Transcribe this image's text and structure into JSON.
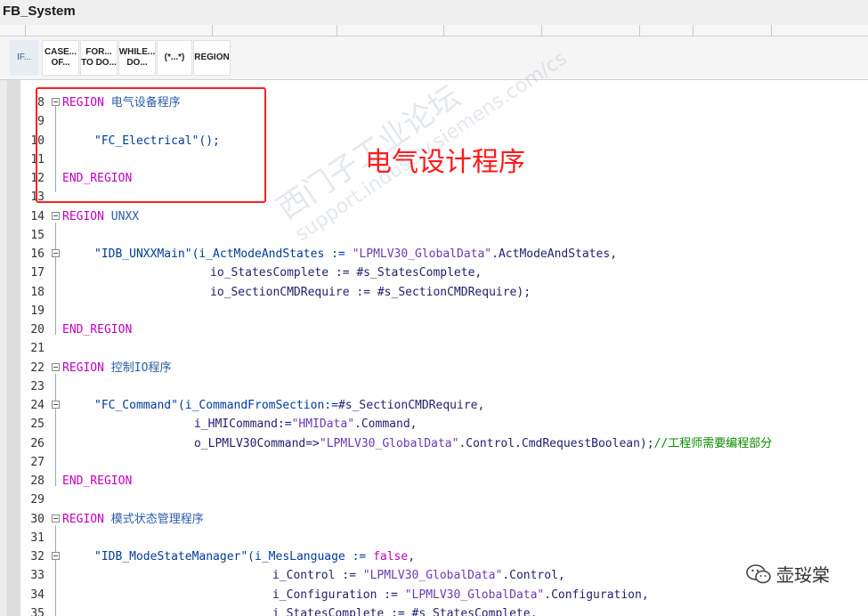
{
  "window": {
    "title": "FB_System"
  },
  "toolbar": {
    "buttons": [
      {
        "name": "if-button",
        "line1": "IF...",
        "line2": ""
      },
      {
        "name": "case-button",
        "line1": "CASE...",
        "line2": "OF..."
      },
      {
        "name": "for-button",
        "line1": "FOR...",
        "line2": "TO DO..."
      },
      {
        "name": "while-button",
        "line1": "WHILE...",
        "line2": "DO..."
      },
      {
        "name": "comment-button",
        "line1": "(*...*)",
        "line2": ""
      },
      {
        "name": "region-button",
        "line1": "REGION",
        "line2": ""
      }
    ]
  },
  "code": {
    "lines": [
      {
        "n": "8"
      },
      {
        "n": "9"
      },
      {
        "n": "10"
      },
      {
        "n": "11"
      },
      {
        "n": "12"
      },
      {
        "n": "13"
      },
      {
        "n": "14"
      },
      {
        "n": "15"
      },
      {
        "n": "16"
      },
      {
        "n": "17"
      },
      {
        "n": "18"
      },
      {
        "n": "19"
      },
      {
        "n": "20"
      },
      {
        "n": "21"
      },
      {
        "n": "22"
      },
      {
        "n": "23"
      },
      {
        "n": "24"
      },
      {
        "n": "25"
      },
      {
        "n": "26"
      },
      {
        "n": "27"
      },
      {
        "n": "28"
      },
      {
        "n": "29"
      },
      {
        "n": "30"
      },
      {
        "n": "31"
      },
      {
        "n": "32"
      },
      {
        "n": "33"
      },
      {
        "n": "34"
      },
      {
        "n": "35"
      }
    ],
    "kw_region": "REGION",
    "kw_end_region": "END_REGION",
    "region1_name": "电气设备程序",
    "region2_name": "UNXX",
    "region3_name": "控制IO程序",
    "region4_name": "模式状态管理程序",
    "l10": "\"FC_Electrical\"();",
    "l16a": "\"IDB_UNXXMain\"(i_ActModeAndStates := ",
    "l16b": "\"LPMLV30_GlobalData\"",
    "l16c": ".ActModeAndStates,",
    "l17": "io_StatesComplete := #s_StatesComplete,",
    "l18": "io_SectionCMDRequire := #s_SectionCMDRequire);",
    "l24a": "\"FC_Command\"(i_CommandFromSection:=",
    "l24b": "#s_SectionCMDRequire,",
    "l25a": "i_HMICommand:=",
    "l25b": "\"HMIData\"",
    "l25c": ".Command,",
    "l26a": "o_LPMLV30Command=>",
    "l26b": "\"LPMLV30_GlobalData\"",
    "l26c": ".Control.CmdRequestBoolean);",
    "l26d": "//工程师需要编程部分",
    "l32a": "\"IDB_ModeStateManager\"(i_MesLanguage := ",
    "l32b": "false",
    "l32c": ",",
    "l33a": "i_Control := ",
    "l33b": "\"LPMLV30_GlobalData\"",
    "l33c": ".Control,",
    "l34a": "i_Configuration := ",
    "l34b": "\"LPMLV30_GlobalData\"",
    "l34c": ".Configuration,",
    "l35": "i_StatesComplete := #s_StatesComplete,"
  },
  "annotation": {
    "text": "电气设计程序"
  },
  "watermark": {
    "line1": "西门子工业论坛",
    "line2": "support.industry.siemens.com/cs"
  },
  "logo": {
    "text": "壶珱棠"
  },
  "colors": {
    "keyword": "#c000c0",
    "comment": "#0a8a00",
    "annotation": "#ff1a1a",
    "highlight_box": "#ff2020"
  }
}
